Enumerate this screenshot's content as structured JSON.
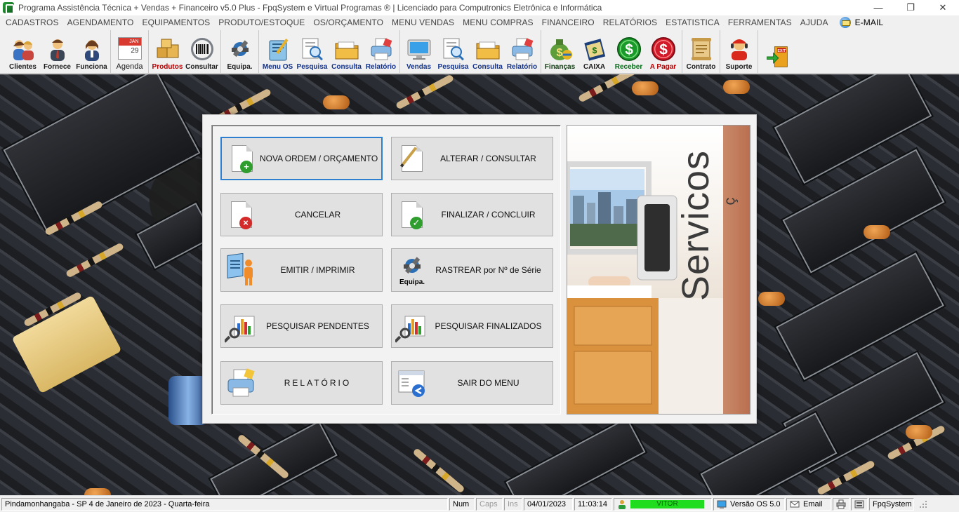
{
  "window": {
    "title": "Programa Assistência Técnica + Vendas + Financeiro v5.0 Plus - FpqSystem e Virtual Programas ® | Licenciado para  Computronics Eletrônica e Informática",
    "minimize": "—",
    "maximize": "❐",
    "close": "✕"
  },
  "menubar": {
    "items": [
      "CADASTROS",
      "AGENDAMENTO",
      "EQUIPAMENTOS",
      "PRODUTO/ESTOQUE",
      "OS/ORÇAMENTO",
      "MENU VENDAS",
      "MENU COMPRAS",
      "FINANCEIRO",
      "RELATÓRIOS",
      "ESTATISTICA",
      "FERRAMENTAS",
      "AJUDA"
    ],
    "email_label": "E-MAIL"
  },
  "toolbar": {
    "clientes": "Clientes",
    "fornece": "Fornece",
    "funciona": "Funciona",
    "agenda": "Agenda",
    "agenda_month": "JAN",
    "agenda_day": "29",
    "produtos": "Produtos",
    "consultar": "Consultar",
    "equipa": "Equipa.",
    "menu_os": "Menu OS",
    "pesquisa_os": "Pesquisa",
    "consulta_os": "Consulta",
    "relatorio_os": "Relatório",
    "vendas": "Vendas",
    "pesquisa_v": "Pesquisa",
    "consulta_v": "Consulta",
    "relatorio_v": "Relatório",
    "financas": "Finanças",
    "caixa": "CAIXA",
    "receber": "Receber",
    "a_pagar": "A Pagar",
    "contrato": "Contrato",
    "suporte": "Suporte",
    "exit_sign": "EXIT",
    "icons": [
      "users-icon",
      "supplier-icon",
      "employee-icon",
      "calendar-icon",
      "boxes-icon",
      "barcode-icon",
      "equipment-icon",
      "clipboard-icon",
      "search-doc-icon",
      "folder-icon",
      "printer-icon",
      "monitor-icon",
      "search-doc-icon",
      "folder-icon",
      "printer-icon",
      "money-bag-icon",
      "cash-book-icon",
      "dollar-green-icon",
      "dollar-red-icon",
      "scroll-icon",
      "support-agent-icon",
      "exit-door-icon"
    ]
  },
  "dialog": {
    "buttons": {
      "nova_ordem": "NOVA ORDEM / ORÇAMENTO",
      "alterar": "ALTERAR  /  CONSULTAR",
      "cancelar": "CANCELAR",
      "finalizar": "FINALIZAR  /  CONCLUIR",
      "emitir": "EMITIR  /  IMPRIMIR",
      "rastrear": "RASTREAR por Nº de Série",
      "rastrear_icon_label": "Equipa.",
      "pesq_pendentes": "PESQUISAR PENDENTES",
      "pesq_finalizados": "PESQUISAR FINALIZADOS",
      "relatorio": "RELATÓRIO",
      "sair": "SAIR DO MENU"
    },
    "side_text": "Servicos",
    "side_text_accent": "ç"
  },
  "statusbar": {
    "location_date": "Pindamonhangaba - SP  4 de Janeiro de 2023 - Quarta-feira",
    "num": "Num",
    "caps": "Caps",
    "ins": "Ins",
    "date": "04/01/2023",
    "time": "11:03:14",
    "user": "VITOR",
    "version": "Versão OS 5.0",
    "email": "Email",
    "brand": "FpqSystem"
  },
  "colors": {
    "focus_border": "#2f7fd0",
    "user_bar": "#1fdc1f",
    "side_strip": "#c98a6a"
  }
}
